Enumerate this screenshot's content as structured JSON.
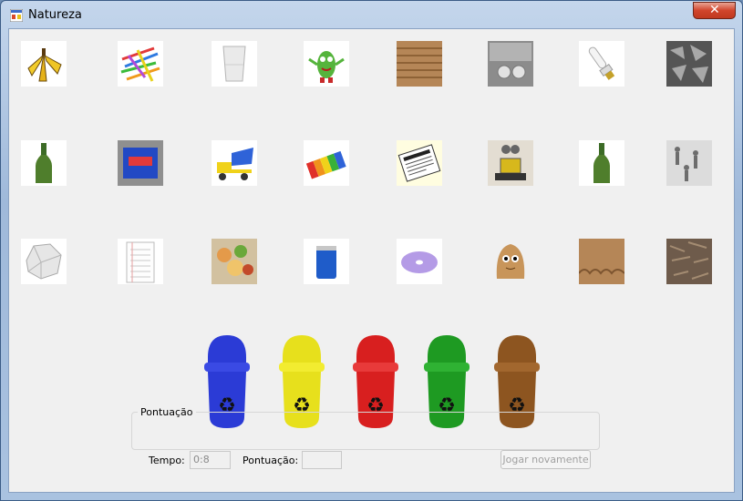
{
  "window": {
    "title": "Natureza"
  },
  "items": [
    {
      "name": "banana-peel-icon"
    },
    {
      "name": "paper-clips-icon"
    },
    {
      "name": "plastic-cup-icon"
    },
    {
      "name": "green-character-toy-icon"
    },
    {
      "name": "corrugated-cardboard-icon"
    },
    {
      "name": "metal-cans-icon"
    },
    {
      "name": "light-bulb-icon"
    },
    {
      "name": "scrap-metal-icon"
    },
    {
      "name": "green-bottle-icon"
    },
    {
      "name": "snack-wrapper-icon"
    },
    {
      "name": "toy-truck-icon"
    },
    {
      "name": "lego-blocks-icon"
    },
    {
      "name": "newspapers-icon"
    },
    {
      "name": "robot-toy-icon"
    },
    {
      "name": "green-bottle-2-icon"
    },
    {
      "name": "toy-soldiers-icon"
    },
    {
      "name": "crumpled-paper-icon"
    },
    {
      "name": "notebook-paper-icon"
    },
    {
      "name": "food-scraps-icon"
    },
    {
      "name": "soda-can-icon"
    },
    {
      "name": "cd-disc-icon"
    },
    {
      "name": "pou-character-icon"
    },
    {
      "name": "cardboard-icon"
    },
    {
      "name": "shredded-wood-icon"
    }
  ],
  "bins": [
    {
      "color": "#2b3bd6",
      "name": "blue-bin"
    },
    {
      "color": "#e7e01c",
      "name": "yellow-bin"
    },
    {
      "color": "#d81f1f",
      "name": "red-bin"
    },
    {
      "color": "#1e9a22",
      "name": "green-bin"
    },
    {
      "color": "#8d5520",
      "name": "brown-bin"
    }
  ],
  "score_panel": {
    "title": "Pontuação",
    "time_label": "Tempo:",
    "time_value": "0:8",
    "score_label": "Pontuação:",
    "score_value": "",
    "play_again_label": "Jogar novamente"
  }
}
